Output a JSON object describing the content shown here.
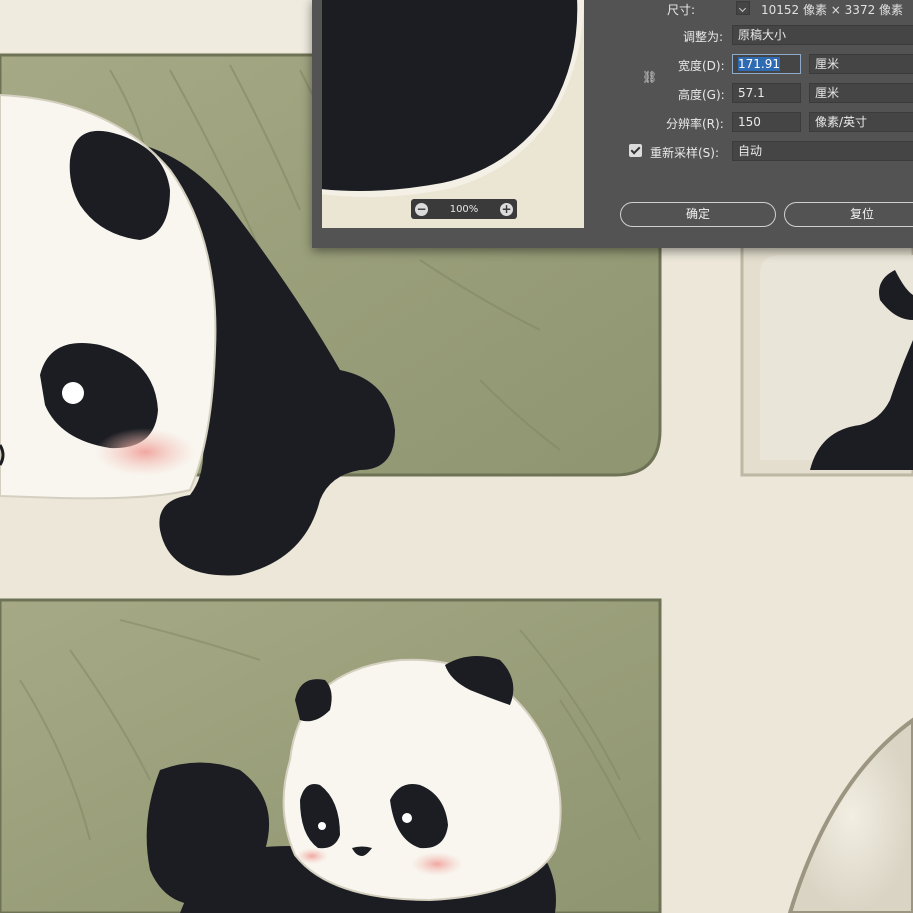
{
  "dialog": {
    "zoom": {
      "minus": "−",
      "label": "100%",
      "plus": "+"
    },
    "dimensions": {
      "label": "尺寸:",
      "value": "10152 像素 × 3372 像素"
    },
    "fit_to": {
      "label": "调整为:",
      "value": "原稿大小"
    },
    "width": {
      "label": "宽度(D):",
      "value": "171.91",
      "unit": "厘米"
    },
    "height": {
      "label": "高度(G):",
      "value": "57.1",
      "unit": "厘米"
    },
    "resolution": {
      "label": "分辨率(R):",
      "value": "150",
      "unit": "像素/英寸"
    },
    "resample": {
      "label": "重新采样(S):",
      "checked": true,
      "value": "自动"
    },
    "link_icon": "chain-link-icon",
    "ok_label": "确定",
    "reset_label": "复位"
  },
  "colors": {
    "dialog_bg": "#535353",
    "field_bg": "#454545",
    "selection": "#2f6bb3",
    "cream": "#ece7d9",
    "olive": "#9aa07a",
    "panda_black": "#1b1d22"
  }
}
